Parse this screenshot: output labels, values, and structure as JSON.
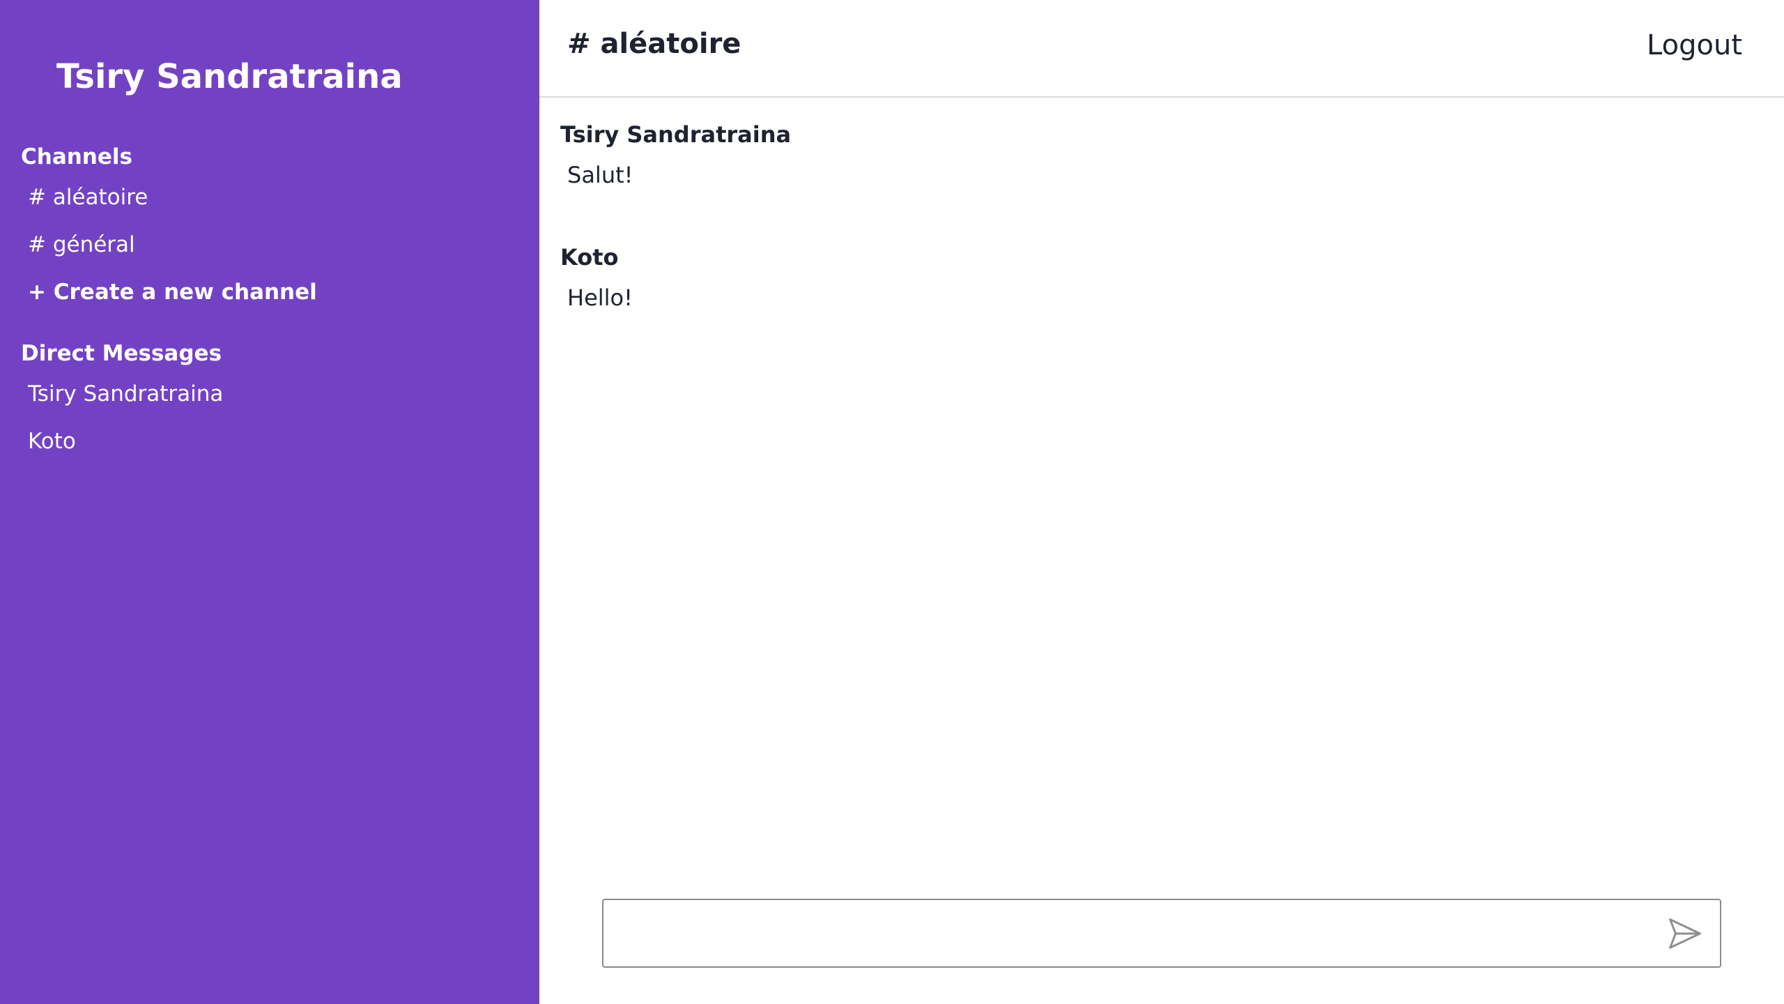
{
  "sidebar": {
    "user_name": "Tsiry Sandratraina",
    "channels_title": "Channels",
    "channels": [
      {
        "label": "# aléatoire"
      },
      {
        "label": "# général"
      }
    ],
    "create_channel_label": "+ Create a new channel",
    "direct_messages_title": "Direct Messages",
    "direct_messages": [
      {
        "label": "Tsiry Sandratraina"
      },
      {
        "label": "Koto"
      }
    ],
    "background_color": "#7342c4"
  },
  "header": {
    "channel_title": "# aléatoire",
    "logout_label": "Logout"
  },
  "messages": [
    {
      "author": "Tsiry Sandratraina",
      "text": "Salut!"
    },
    {
      "author": "Koto",
      "text": "Hello!"
    }
  ],
  "composer": {
    "value": "",
    "placeholder": "",
    "send_icon": "send-icon"
  }
}
